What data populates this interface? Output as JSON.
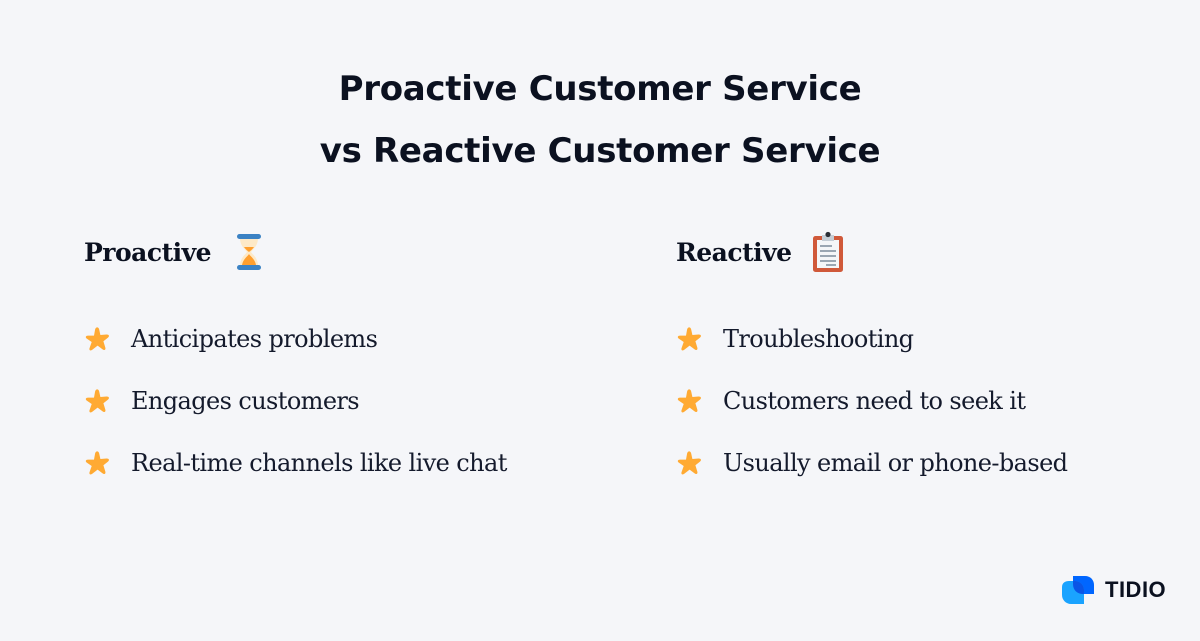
{
  "title": {
    "line1": "Proactive Customer Service",
    "line2": "vs Reactive Customer Service"
  },
  "columns": [
    {
      "heading": "Proactive",
      "icon": "hourglass-icon",
      "items": [
        {
          "icon": "star-icon",
          "text": "Anticipates problems"
        },
        {
          "icon": "star-icon",
          "text": "Engages customers"
        },
        {
          "icon": "star-icon",
          "text": "Real-time channels like live chat"
        }
      ]
    },
    {
      "heading": "Reactive",
      "icon": "clipboard-icon",
      "items": [
        {
          "icon": "star-icon",
          "text": "Troubleshooting"
        },
        {
          "icon": "star-icon",
          "text": "Customers need to seek it"
        },
        {
          "icon": "star-icon",
          "text": "Usually email or phone-based"
        }
      ]
    }
  ],
  "brand": {
    "name": "TIDIO",
    "icon": "tidio-logo-icon"
  },
  "colors": {
    "background": "#f5f6f9",
    "text": "#0b1120",
    "star": "#ffaa33",
    "hourglass_cap": "#3b82c4",
    "hourglass_sand": "#ff9f2e",
    "clipboard_frame": "#d0593a",
    "brand_blue_dark": "#0066ff",
    "brand_blue_light": "#1aa3ff"
  }
}
